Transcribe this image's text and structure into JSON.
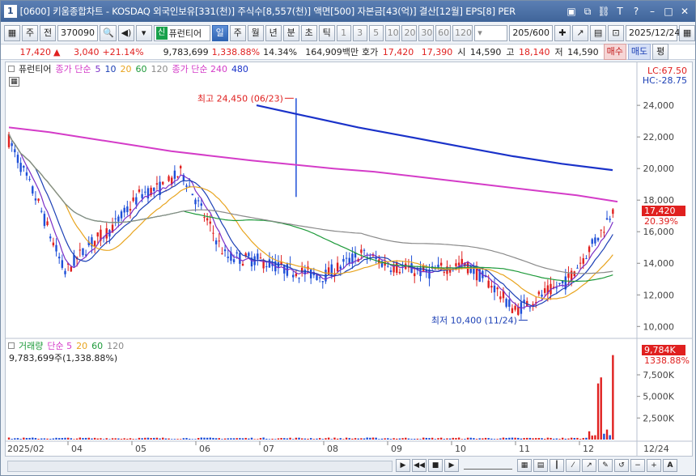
{
  "window": {
    "number": "1",
    "title": "[0600] 키움종합차트 - KOSDAQ 외국인보유[331(천)] 주식수[8,557(천)] 액면[500] 자본금[43(억)] 결산[12월] EPS[8] PER"
  },
  "toolbar": {
    "type_label": "주",
    "prev_label": "전",
    "code": "370090",
    "stock_name": "퓨런티어",
    "shin_badge": "신",
    "periods": [
      "일",
      "주",
      "월",
      "년",
      "분",
      "초",
      "틱"
    ],
    "intervals": [
      "1",
      "3",
      "5",
      "10",
      "20",
      "30",
      "60",
      "120"
    ],
    "count": "205",
    "total": "/600",
    "date": "2025/12/24"
  },
  "quote": {
    "price": "17,420",
    "change": "3,040",
    "change_pct": "+21.14%",
    "volume": "9,783,699",
    "volume_pct": "1,338.88%",
    "turnover_pct": "14.34%",
    "amount": "164,909백만",
    "bid_label": "호가",
    "bid": "17,420",
    "ask": "17,390",
    "open_label": "시",
    "open": "14,590",
    "high_label": "고",
    "high": "18,140",
    "low_label": "저",
    "low": "14,590",
    "buy_label": "매수",
    "sell_label": "매도",
    "eval_label": "평"
  },
  "legend_price": {
    "name": "퓨런티어",
    "ma_label": "종가 단순",
    "ma5": "5",
    "ma10": "10",
    "ma20": "20",
    "ma60": "60",
    "ma120": "120",
    "ma240_label": "종가 단순 240",
    "ma480": "480"
  },
  "legend_volume": {
    "name": "거래량",
    "ma_label": "단순 5",
    "ma20": "20",
    "ma60": "60",
    "ma120": "120",
    "value": "9,783,699주(1,338.88%)"
  },
  "right_labels": {
    "lc": "LC:67.50",
    "hc": "HC:-28.75",
    "price_tag": "17,420",
    "pct_tag": "20.39%",
    "vol_tag": "9,784K",
    "vol_pct_tag": "1338.88%"
  },
  "chart_data": {
    "type": "candlestick",
    "price_axis_ticks": [
      "24,000",
      "22,000",
      "20,000",
      "18,000",
      "16,000",
      "14,000",
      "12,000",
      "10,000"
    ],
    "price_ylim": [
      9400,
      25800
    ],
    "volume_axis_ticks": [
      "7,500K",
      "5,000K",
      "2,500K"
    ],
    "volume_ylim": [
      0,
      10500000
    ],
    "x_ticks": [
      "2025/02",
      "04",
      "05",
      "06",
      "07",
      "08",
      "09",
      "10",
      "11",
      "12",
      "12/24"
    ],
    "annotations": {
      "high": "최고 24,450 (06/23)",
      "low": "최저 10,400 (11/24)"
    },
    "colors": {
      "up": "#e0201f",
      "down": "#1e4fd8",
      "ma5": "#7a2fc7",
      "ma10": "#1b3fb5",
      "ma20": "#e8a41e",
      "ma60": "#1e9a3a",
      "ma120": "#8a8a8a",
      "ma240": "#d43cc8",
      "ma480": "#1a32c9"
    },
    "ma240": [
      22600,
      22300,
      21900,
      21500,
      21100,
      20800,
      20500,
      20250,
      20000,
      19800,
      19500,
      19200,
      18900,
      18600,
      18300,
      17900
    ],
    "ma480": [
      24000,
      23300,
      22600,
      22000,
      21400,
      20800,
      20300,
      19900
    ]
  }
}
